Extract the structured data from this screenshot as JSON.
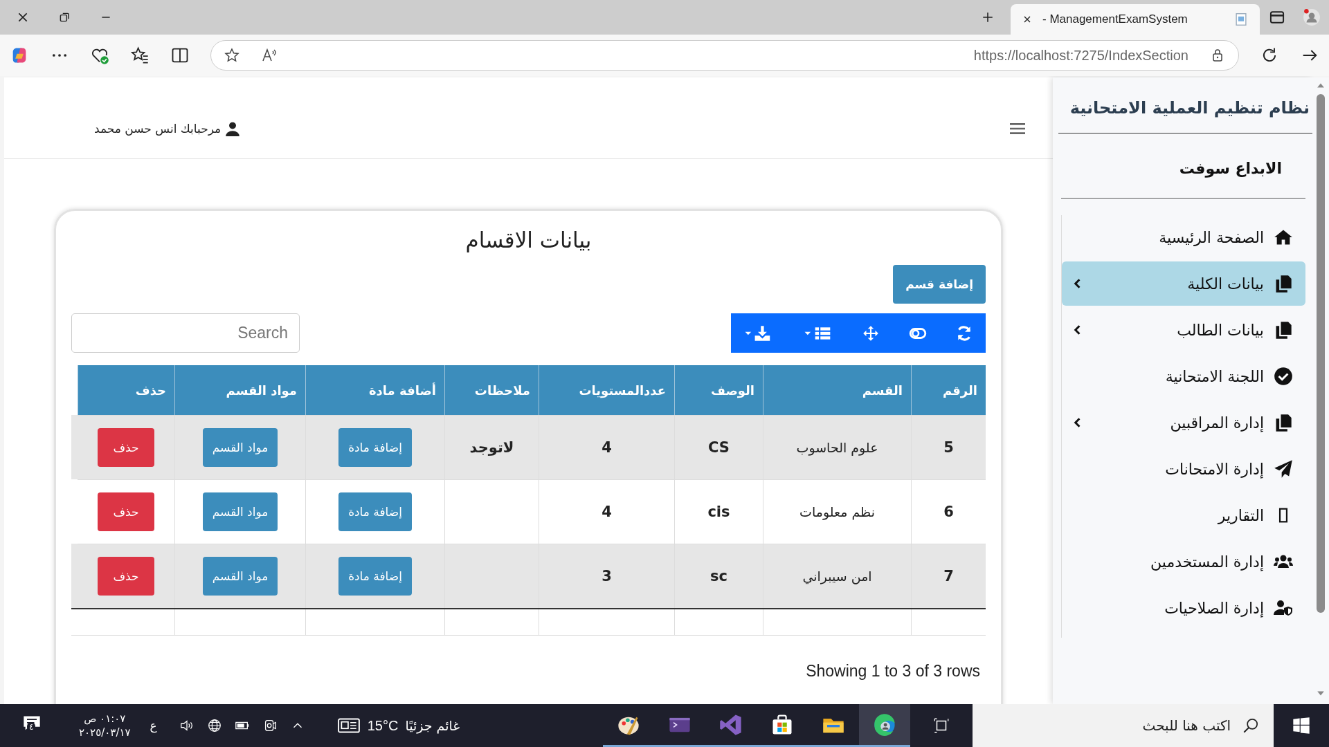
{
  "browser": {
    "tab_title": "- ManagementExamSystem",
    "url_host": "https://localhost",
    "url_rest": ":7275/IndexSection"
  },
  "header": {
    "greeting": "مرحبابك انس حسن محمد"
  },
  "sidebar": {
    "title": "نظام تنظيم العملية الامتحانية",
    "brand": "الابداع سوفت",
    "items": [
      {
        "label": "الصفحة الرئيسية",
        "selected": false,
        "submenu": false
      },
      {
        "label": "بيانات الكلية",
        "selected": true,
        "submenu": true
      },
      {
        "label": "بيانات الطالب",
        "selected": false,
        "submenu": true
      },
      {
        "label": "اللجنة الامتحانية",
        "selected": false,
        "submenu": false
      },
      {
        "label": "إدارة المراقبين",
        "selected": false,
        "submenu": true
      },
      {
        "label": "إدارة الامتحانات",
        "selected": false,
        "submenu": false
      },
      {
        "label": "التقارير",
        "selected": false,
        "submenu": false
      },
      {
        "label": "إدارة المستخدمين",
        "selected": false,
        "submenu": false
      },
      {
        "label": "إدارة الصلاحيات",
        "selected": false,
        "submenu": false
      }
    ]
  },
  "card": {
    "title": "بيانات الاقسام",
    "add_button": "إضافة قسم",
    "search": {
      "placeholder": "Search"
    },
    "table": {
      "columns": [
        "الرقم",
        "القسم",
        "الوصف",
        "عددالمستويات",
        "ملاحظات",
        "أضافة مادة",
        "مواد القسم",
        "حذف"
      ],
      "rows": [
        {
          "number": "5",
          "section": "علوم الحاسوب",
          "description": "CS",
          "levels": "4",
          "notes": "لاتوجد",
          "add_subject": "إضافة مادة",
          "subjects": "مواد القسم",
          "delete": "حذف"
        },
        {
          "number": "6",
          "section": "نظم معلومات",
          "description": "cis",
          "levels": "4",
          "notes": "",
          "add_subject": "إضافة مادة",
          "subjects": "مواد القسم",
          "delete": "حذف"
        },
        {
          "number": "7",
          "section": "امن سيبراني",
          "description": "sc",
          "levels": "3",
          "notes": "",
          "add_subject": "إضافة مادة",
          "subjects": "مواد القسم",
          "delete": "حذف"
        }
      ]
    },
    "footer": "Showing 1 to 3 of 3 rows"
  },
  "taskbar": {
    "notifications": "٤",
    "time": "٠١:٠٧ ص",
    "date": "٢٠٢٥/٠٣/١٧",
    "language": "ع",
    "temperature": "15°C",
    "weather": "غائم جزئيًا",
    "search_placeholder": "اكتب هنا للبحث"
  }
}
